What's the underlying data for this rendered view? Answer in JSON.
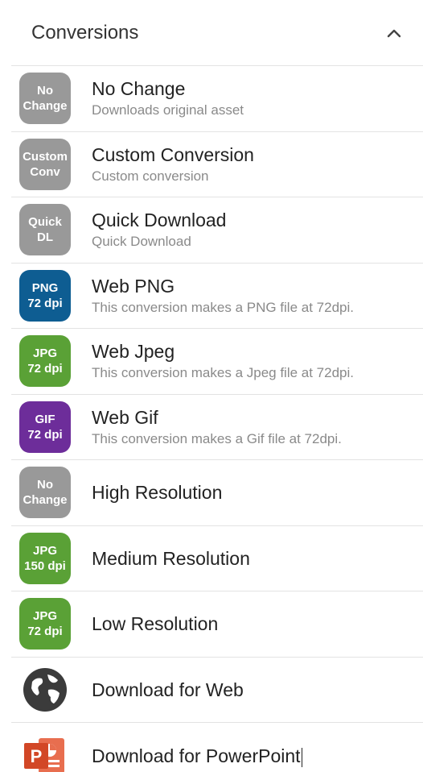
{
  "header": {
    "title": "Conversions",
    "toggle_icon": "chevron-up-icon"
  },
  "items": [
    {
      "name": "No Change",
      "description": "Downloads original asset",
      "badge": [
        "No",
        "Change"
      ],
      "badge_color": "#999999"
    },
    {
      "name": "Custom Conversion",
      "description": "Custom conversion",
      "badge": [
        "Custom",
        "Conv"
      ],
      "badge_color": "#999999"
    },
    {
      "name": "Quick Download",
      "description": "Quick Download",
      "badge": [
        "Quick",
        "DL"
      ],
      "badge_color": "#999999"
    },
    {
      "name": "Web PNG",
      "description": "This conversion makes a PNG file at 72dpi.",
      "badge": [
        "PNG",
        "72 dpi"
      ],
      "badge_color": "#0e5d92"
    },
    {
      "name": "Web Jpeg",
      "description": "This conversion makes a Jpeg file at 72dpi.",
      "badge": [
        "JPG",
        "72 dpi"
      ],
      "badge_color": "#5aa136"
    },
    {
      "name": "Web Gif",
      "description": "This conversion makes a Gif file at 72dpi.",
      "badge": [
        "GIF",
        "72 dpi"
      ],
      "badge_color": "#6d2d9a"
    },
    {
      "name": "High Resolution",
      "description": "",
      "badge": [
        "No",
        "Change"
      ],
      "badge_color": "#999999"
    },
    {
      "name": "Medium Resolution",
      "description": "",
      "badge": [
        "JPG",
        "150 dpi"
      ],
      "badge_color": "#5aa136"
    },
    {
      "name": "Low Resolution",
      "description": "",
      "badge": [
        "JPG",
        "72 dpi"
      ],
      "badge_color": "#5aa136"
    },
    {
      "name": "Download for Web",
      "description": "",
      "icon": "globe-icon",
      "icon_color": "#3b3b3b"
    },
    {
      "name": "Download for PowerPoint",
      "description": "",
      "icon": "powerpoint-icon",
      "icon_color": "#d24726"
    }
  ]
}
